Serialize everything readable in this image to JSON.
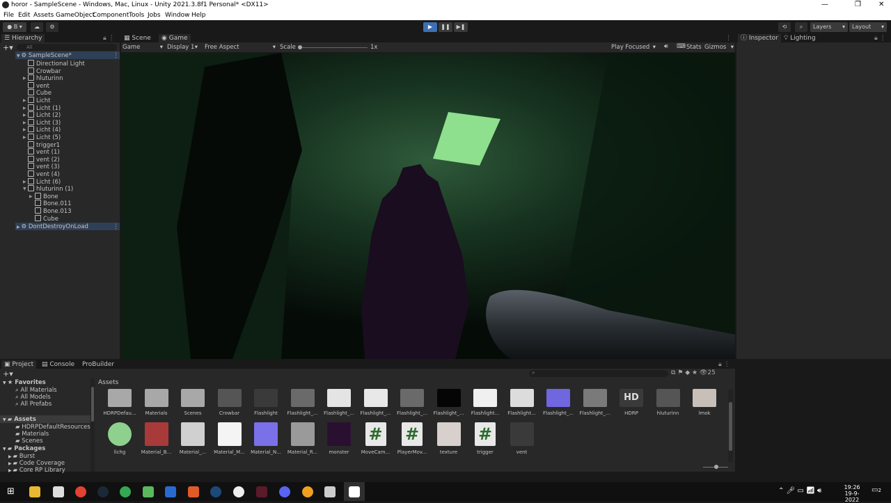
{
  "window": {
    "title": "horor - SampleScene - Windows, Mac, Linux - Unity 2021.3.8f1 Personal* <DX11>"
  },
  "menu": [
    "File",
    "Edit",
    "Assets",
    "GameObject",
    "Component",
    "Tools",
    "Jobs",
    "Window",
    "Help"
  ],
  "toolbar": {
    "account_label": "B",
    "layers_label": "Layers",
    "layout_label": "Layout"
  },
  "hierarchy": {
    "tab_label": "Hierarchy",
    "search_placeholder": "All",
    "scene_name": "SampleScene*",
    "items": [
      "Directional Light",
      "Crowbar",
      "hluturinn",
      "vent",
      "Cube",
      "Licht",
      "Licht (1)",
      "Licht (2)",
      "Licht (3)",
      "Licht (4)",
      "Licht (5)",
      "trigger1",
      "vent (1)",
      "vent (2)",
      "vent (3)",
      "vent (4)",
      "Licht (6)",
      "hluturinn (1)"
    ],
    "children": [
      "Bone",
      "Bone.011",
      "Bone.013",
      "Cube"
    ],
    "dont_destroy": "DontDestroyOnLoad"
  },
  "center_tabs": {
    "scene": "Scene",
    "game": "Game"
  },
  "game_toolbar": {
    "mode": "Game",
    "display": "Display 1",
    "aspect": "Free Aspect",
    "scale_label": "Scale",
    "scale_value": "1x",
    "play_focused": "Play Focused",
    "stats": "Stats",
    "gizmos": "Gizmos"
  },
  "right_tabs": {
    "inspector": "Inspector",
    "lighting": "Lighting"
  },
  "bottom_tabs": {
    "project": "Project",
    "console": "Console",
    "probuilder": "ProBuilder"
  },
  "project": {
    "favorites_label": "Favorites",
    "favorites": [
      "All Materials",
      "All Models",
      "All Prefabs"
    ],
    "assets_label": "Assets",
    "assets_folders": [
      "HDRPDefaultResources",
      "Materials",
      "Scenes"
    ],
    "packages_label": "Packages",
    "packages": [
      "Burst",
      "Code Coverage",
      "Core RP Library"
    ],
    "breadcrumb": "Assets",
    "hidden_count": "25",
    "row1": [
      {
        "label": "HDRPDefau...",
        "color": "#a8a8a8"
      },
      {
        "label": "Materials",
        "color": "#a8a8a8"
      },
      {
        "label": "Scenes",
        "color": "#a8a8a8"
      },
      {
        "label": "Crowbar",
        "color": "#555555"
      },
      {
        "label": "Flashlight",
        "color": "#3a3a3a"
      },
      {
        "label": "Flashlight_...",
        "color": "#6a6a6a"
      },
      {
        "label": "Flashlight_...",
        "color": "#e4e4e4"
      },
      {
        "label": "Flashlight_...",
        "color": "#e8e8e8"
      },
      {
        "label": "Flashlight_...",
        "color": "#6a6a6a"
      },
      {
        "label": "Flashlight_...",
        "color": "#050505"
      },
      {
        "label": "Flashlight...",
        "color": "#f0f0f0"
      },
      {
        "label": "Flashlight...",
        "color": "#dcdcdc"
      },
      {
        "label": "Flashlight_...",
        "color": "#6f66e0"
      },
      {
        "label": "Flashlight_...",
        "color": "#7a7a7a"
      },
      {
        "label": "HDRP",
        "color": "#3a3a3a"
      },
      {
        "label": "hluturinn",
        "color": "#555555"
      },
      {
        "label": "lmok",
        "color": "#c8c0b8"
      }
    ],
    "row2": [
      {
        "label": "lichg",
        "color": "#8ed08e"
      },
      {
        "label": "Material_B...",
        "color": "#a83a3a"
      },
      {
        "label": "Material_...",
        "color": "#d0d0d0"
      },
      {
        "label": "Material_M...",
        "color": "#f4f4f4"
      },
      {
        "label": "Material_N...",
        "color": "#7a70e8"
      },
      {
        "label": "Material_R...",
        "color": "#9a9a9a"
      },
      {
        "label": "monster",
        "color": "#2a1030"
      },
      {
        "label": "MoveCam...",
        "color": "#e8e8e8"
      },
      {
        "label": "PlayerMov...",
        "color": "#e8e8e8"
      },
      {
        "label": "texture",
        "color": "#d8d0cc"
      },
      {
        "label": "trigger",
        "color": "#e8e8e8"
      },
      {
        "label": "vent",
        "color": "#3a3a3a"
      }
    ]
  },
  "taskbar": {
    "time": "19:26",
    "date": "19-9-2022",
    "notifications": "2"
  }
}
